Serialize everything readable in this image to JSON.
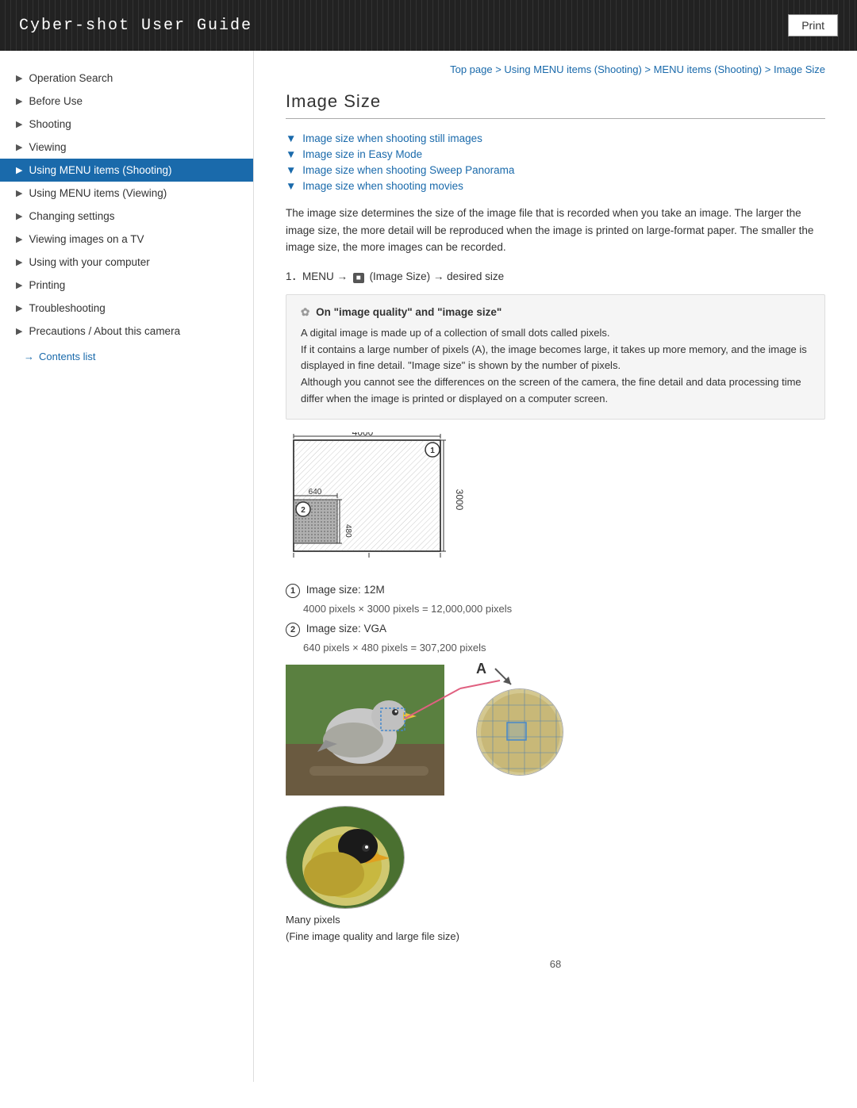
{
  "header": {
    "title": "Cyber-shot User Guide",
    "print_label": "Print"
  },
  "breadcrumb": {
    "text": "Top page > Using MENU items (Shooting) > MENU items (Shooting) > Image Size"
  },
  "sidebar": {
    "items": [
      {
        "label": "Operation Search",
        "active": false
      },
      {
        "label": "Before Use",
        "active": false
      },
      {
        "label": "Shooting",
        "active": false
      },
      {
        "label": "Viewing",
        "active": false
      },
      {
        "label": "Using MENU items (Shooting)",
        "active": true
      },
      {
        "label": "Using MENU items (Viewing)",
        "active": false
      },
      {
        "label": "Changing settings",
        "active": false
      },
      {
        "label": "Viewing images on a TV",
        "active": false
      },
      {
        "label": "Using with your computer",
        "active": false
      },
      {
        "label": "Printing",
        "active": false
      },
      {
        "label": "Troubleshooting",
        "active": false
      },
      {
        "label": "Precautions / About this camera",
        "active": false
      }
    ],
    "contents_link": "Contents list"
  },
  "main": {
    "page_title": "Image Size",
    "links": [
      "Image size when shooting still images",
      "Image size in Easy Mode",
      "Image size when shooting Sweep Panorama",
      "Image size when shooting movies"
    ],
    "body_text1": "The image size determines the size of the image file that is recorded when you take an image. The larger the image size, the more detail will be reproduced when the image is printed on large-format paper. The smaller the image size, the more images can be recorded.",
    "menu_instruction": "1．MENU →  (Image Size) → desired size",
    "tip_title": "On \"image quality\" and \"image size\"",
    "tip_text": "A digital image is made up of a collection of small dots called pixels.\nIf it contains a large number of pixels (A), the image becomes large, it takes up more memory, and the image is displayed in fine detail. \"Image size\" is shown by the number of pixels.\nAlthough you cannot see the differences on the screen of the camera, the fine detail and data processing time differ when the image is printed or displayed on a computer screen.",
    "size1_label": "Image size: 12M",
    "size1_detail": "4000 pixels × 3000 pixels = 12,000,000 pixels",
    "size2_label": "Image size: VGA",
    "size2_detail": "640 pixels × 480 pixels = 307,200 pixels",
    "caption1": "Many pixels",
    "caption2": "(Fine image quality and large file size)",
    "page_number": "68",
    "diagram": {
      "outer_width": "4000",
      "outer_height": "3000",
      "inner_width": "640",
      "inner_height": "480"
    }
  }
}
